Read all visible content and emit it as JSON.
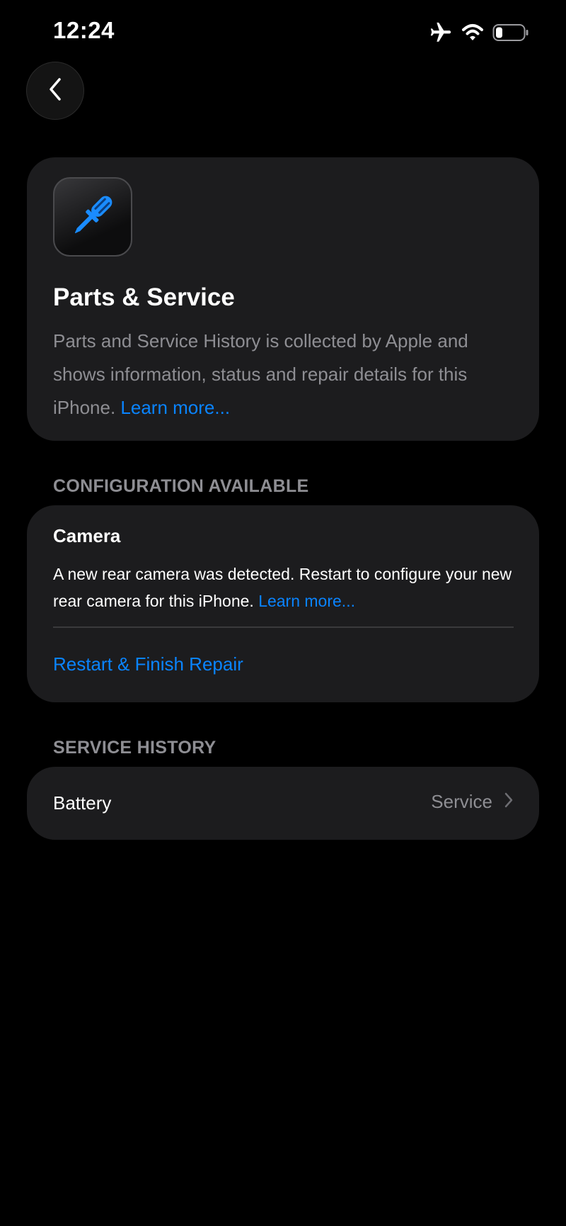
{
  "status_bar": {
    "time": "12:24",
    "icons": [
      "airplane-icon",
      "wifi-icon",
      "battery-icon"
    ]
  },
  "nav": {
    "back_icon": "chevron-left-icon"
  },
  "hero": {
    "icon": "screwdriver-icon",
    "title": "Parts & Service",
    "description": "Parts and Service History is collected by Apple and shows information, status and repair details for this iPhone.",
    "link": "Learn more..."
  },
  "configuration": {
    "header": "CONFIGURATION AVAILABLE",
    "item_title": "Camera",
    "description": "A new rear camera was detected. Restart to configure your new rear camera for this iPhone.",
    "link": "Learn more...",
    "action": "Restart & Finish Repair"
  },
  "service_history": {
    "header": "SERVICE HISTORY",
    "items": [
      {
        "label": "Battery",
        "value": "Service"
      }
    ]
  },
  "colors": {
    "background": "#000000",
    "card": "#1c1c1e",
    "accent": "#0a84ff",
    "secondary_text": "#8e8e93",
    "icon_blue": "#1a8cff"
  }
}
